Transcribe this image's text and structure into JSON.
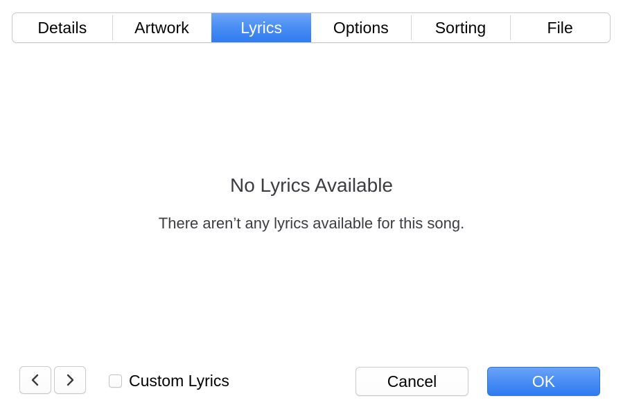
{
  "tabs": [
    {
      "label": "Details",
      "selected": false
    },
    {
      "label": "Artwork",
      "selected": false
    },
    {
      "label": "Lyrics",
      "selected": true
    },
    {
      "label": "Options",
      "selected": false
    },
    {
      "label": "Sorting",
      "selected": false
    },
    {
      "label": "File",
      "selected": false
    }
  ],
  "main": {
    "title": "No Lyrics Available",
    "subtitle": "There aren’t any lyrics available for this song."
  },
  "bottom": {
    "previous_icon": "chevron-left-icon",
    "next_icon": "chevron-right-icon",
    "custom_lyrics_label": "Custom Lyrics",
    "custom_lyrics_checked": false,
    "cancel_label": "Cancel",
    "ok_label": "OK"
  },
  "colors": {
    "accent_blue_top": "#6aa3f7",
    "accent_blue_bottom": "#2e7cf0",
    "text_primary": "#000000",
    "text_muted": "#3c3c42",
    "border": "#c8c8c8",
    "background": "#ffffff"
  }
}
